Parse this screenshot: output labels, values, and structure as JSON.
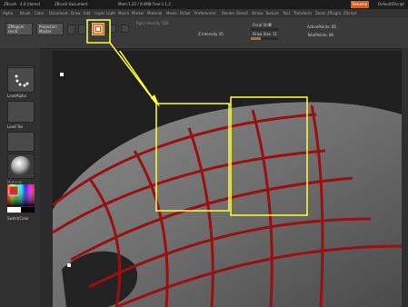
{
  "titlebar": {
    "app_name": "ZBrush",
    "version_tag": "4.0 [demo]",
    "document": "ZBrush Document",
    "memory": "Mem:1.22 / 9.4MB  Free:1.1.2",
    "close_label": "Rename",
    "script": "DefaultZScript"
  },
  "menu": [
    "Alpha",
    "Brush",
    "Color",
    "Document",
    "Draw",
    "Edit",
    "Layer",
    "Light",
    "Macro",
    "Marker",
    "Material",
    "Movie",
    "Picker",
    "Preferences",
    "Render",
    "Stencil",
    "Stroke",
    "Texture",
    "Tool",
    "Transform",
    "Zoom",
    "ZPlugin",
    "ZScript"
  ],
  "toolbar": {
    "zmapper": "ZMapper",
    "rev_label": "rev-E",
    "projection_master": "Projection Master",
    "focal_shift": "Focal Shift",
    "focal_shift_value": "0",
    "draw_size": "Draw Size",
    "draw_size_value": "11",
    "active_points": "ActivePoints: 85",
    "total_points": "TotalPoints: 86",
    "rgb_intensity": "Rgb Intensity 100",
    "z_intensity": "Z Intensity 25",
    "focal_level": 0.0,
    "draw_size_level": 0.35
  },
  "leftpanel": {
    "tile1_label": "LoadAlpha",
    "tile2_label": "Load Tex",
    "tile3_label": "Material",
    "switch_color": "SwitchColor"
  },
  "colors": {
    "accent": "#c8641c",
    "highlight_box": "#ffff33",
    "curve": "#9a1010"
  }
}
